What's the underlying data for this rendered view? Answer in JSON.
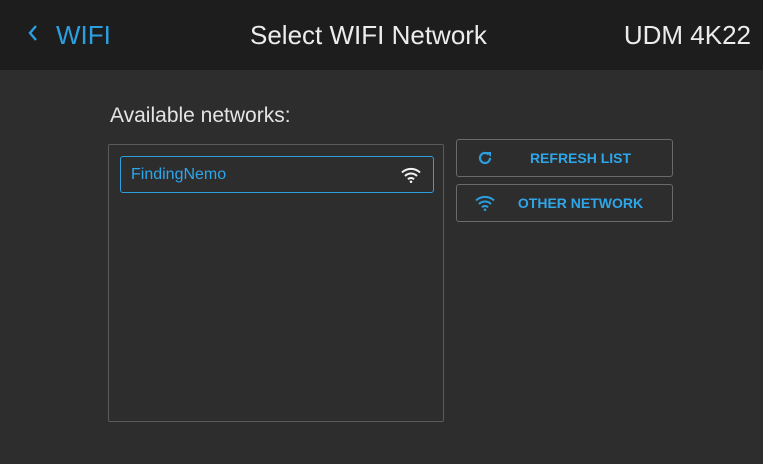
{
  "header": {
    "back_label": "WIFI",
    "title": "Select WIFI Network",
    "device_name": "UDM 4K22"
  },
  "main": {
    "section_label": "Available networks:",
    "networks": [
      {
        "name": "FindingNemo",
        "icon": "wifi-signal-icon",
        "selected": true
      }
    ],
    "buttons": {
      "refresh_label": "REFRESH LIST",
      "refresh_icon": "refresh-icon",
      "other_label": "OTHER NETWORK",
      "other_icon": "wifi-icon"
    }
  },
  "colors": {
    "accent": "#2b9fe0",
    "header_bg": "#1d1d1d",
    "background": "#2d2d2d",
    "text": "#e8e8e8"
  }
}
